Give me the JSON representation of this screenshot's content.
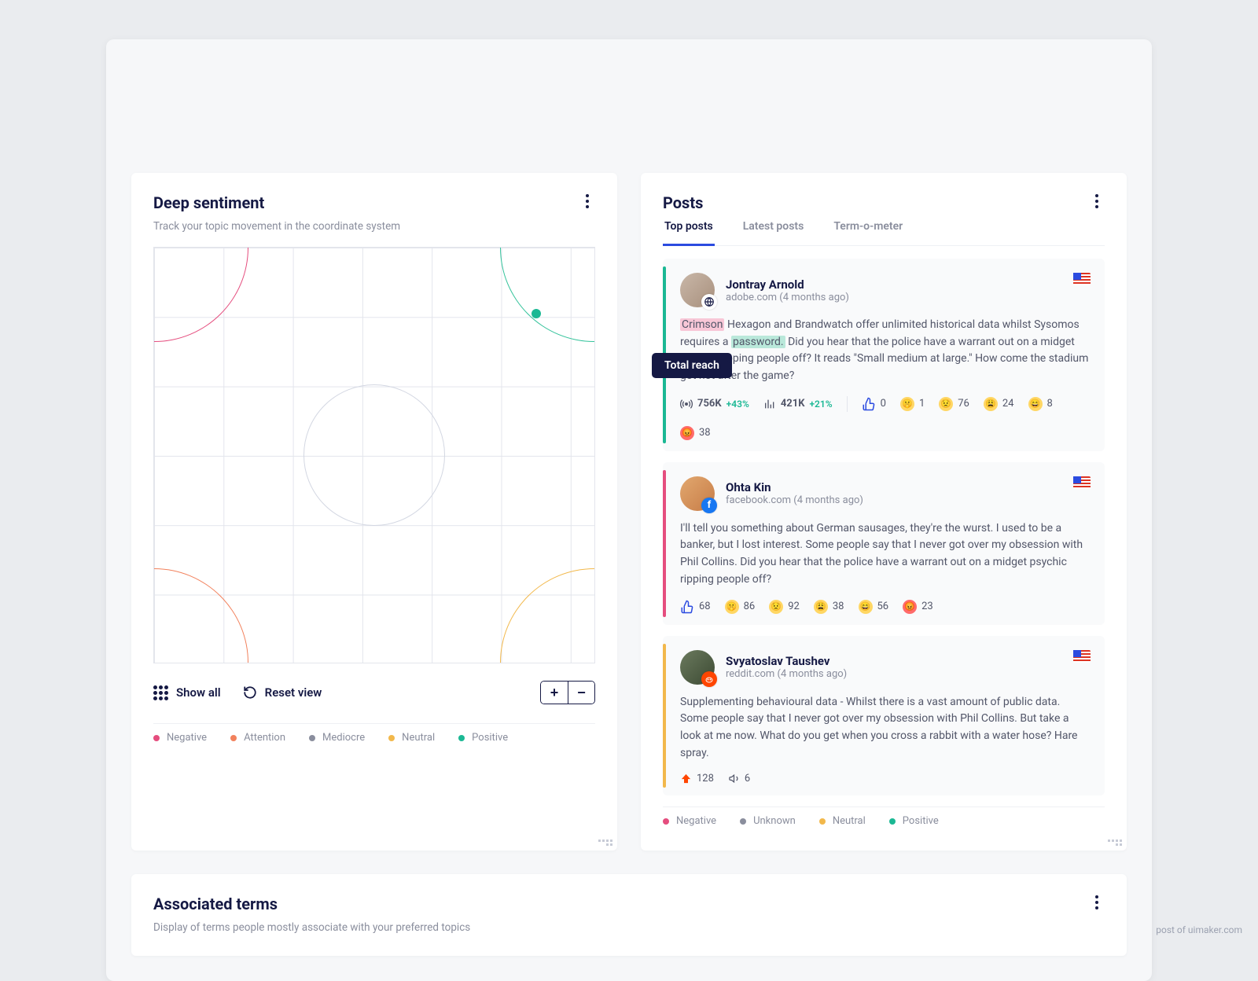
{
  "sentiment": {
    "title": "Deep sentiment",
    "subtitle": "Track your topic movement in the coordinate system",
    "toolbar": {
      "show_all": "Show all",
      "reset_view": "Reset view"
    },
    "legend": [
      {
        "label": "Negative",
        "color": "#e54d7e"
      },
      {
        "label": "Attention",
        "color": "#f2815c"
      },
      {
        "label": "Mediocre",
        "color": "#8a8e9d"
      },
      {
        "label": "Neutral",
        "color": "#f2b84b"
      },
      {
        "label": "Positive",
        "color": "#1bb894"
      }
    ]
  },
  "tooltip_text": "Total reach",
  "posts": {
    "title": "Posts",
    "tabs": [
      "Top posts",
      "Latest posts",
      "Term-o-meter"
    ],
    "active_tab": 0,
    "legend": [
      {
        "label": "Negative",
        "color": "#e54d7e"
      },
      {
        "label": "Unknown",
        "color": "#8a8e9d"
      },
      {
        "label": "Neutral",
        "color": "#f2b84b"
      },
      {
        "label": "Positive",
        "color": "#1bb894"
      }
    ],
    "items": [
      {
        "stripe": "green",
        "name": "Jontray Arnold",
        "source": "adobe.com",
        "age": "(4 months ago)",
        "badge": "globe",
        "hl1": "Crimson",
        "mid1": " Hexagon and Brandwatch offer unlimited historical data whilst Sysomos requires a ",
        "hl2": "password.",
        "rest": " Did you hear that the police have a warrant out on a midget psychic ripping people off? It reads \"Small medium at large.\" How come the stadium got hot after the game?",
        "reach": "756K",
        "reach_delta": "+43%",
        "eng": "421K",
        "eng_delta": "+21%",
        "reacts": [
          "0",
          "1",
          "76",
          "24",
          "8",
          "38"
        ]
      },
      {
        "stripe": "pink",
        "name": "Ohta Kin",
        "source": "facebook.com",
        "age": "(4 months ago)",
        "badge": "facebook",
        "body": "I'll tell you something about German sausages, they're the wurst. I used to be a banker, but I lost interest. Some people say that I never got over my obsession with Phil Collins. Did you hear that the police have a warrant out on a midget psychic ripping people off?",
        "reacts": [
          "68",
          "86",
          "92",
          "38",
          "56",
          "23"
        ]
      },
      {
        "stripe": "amber",
        "name": "Svyatoslav Taushev",
        "source": "reddit.com",
        "age": "(4 months ago)",
        "badge": "reddit",
        "body": "Supplementing behavioural data - Whilst there is a vast amount of public data. Some people say that I never got over my obsession with Phil Collins. But take a look at me now. What do you get when you cross a rabbit with a water hose? Hare spray.",
        "upvotes": "128",
        "announce": "6"
      }
    ]
  },
  "associated": {
    "title": "Associated terms",
    "subtitle": "Display of terms people mostly associate with your preferred topics"
  },
  "watermark": "post of uimaker.com"
}
